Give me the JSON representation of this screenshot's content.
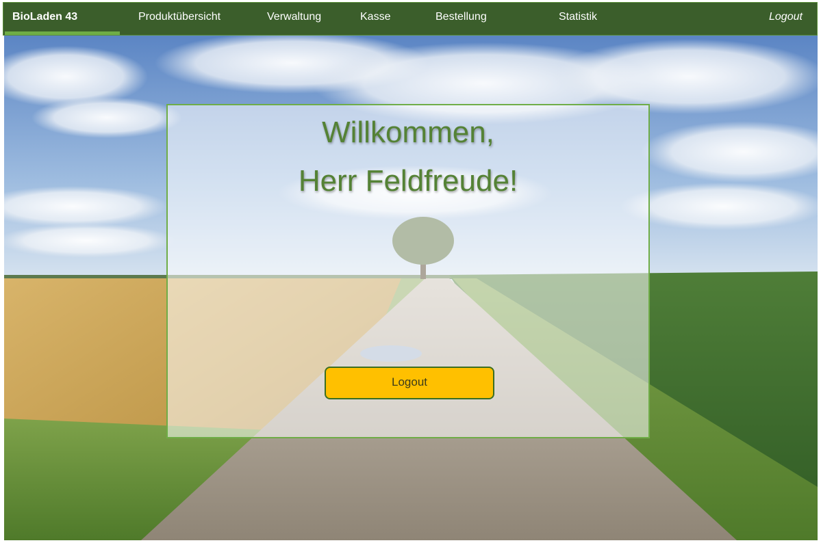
{
  "navbar": {
    "brand": "BioLaden 43",
    "items": [
      {
        "label": "Produktübersicht"
      },
      {
        "label": "Verwaltung"
      },
      {
        "label": "Kasse"
      },
      {
        "label": "Bestellung"
      },
      {
        "label": "Statistik"
      }
    ],
    "logout": "Logout"
  },
  "panel": {
    "greeting_line1": "Willkommen,",
    "greeting_line2": "Herr Feldfreude!",
    "logout_button": "Logout"
  },
  "colors": {
    "navbar_bg": "#3b5e2b",
    "accent_green": "#6fad47",
    "heading_green": "#548235",
    "button_yellow": "#ffc000"
  },
  "icons": {
    "background": "landscape-photo"
  }
}
